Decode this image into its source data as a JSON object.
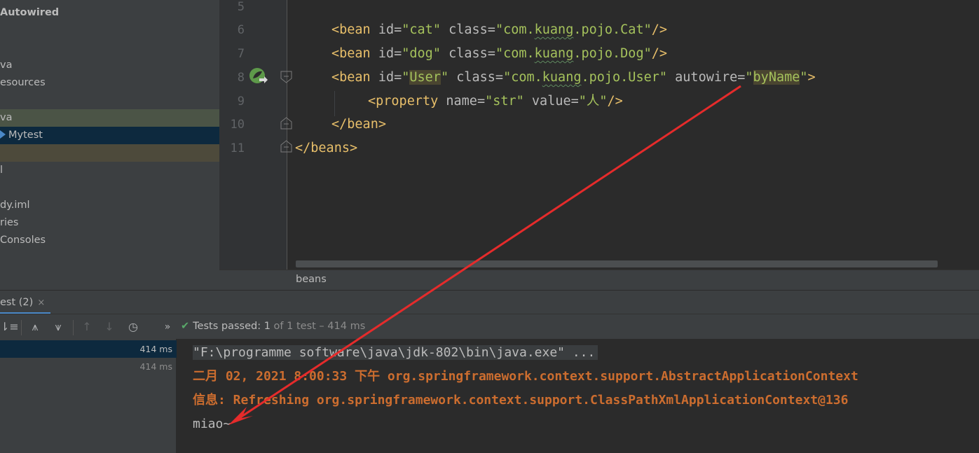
{
  "project_tree": {
    "items": [
      {
        "label": "Autowired",
        "style": "bold"
      },
      {
        "label": "va",
        "style": ""
      },
      {
        "label": "esources",
        "style": ""
      },
      {
        "label": "va",
        "style": "sel-green"
      },
      {
        "label": "Mytest",
        "style": "sel-blue"
      },
      {
        "label": "",
        "style": "sel-olive"
      },
      {
        "label": "l",
        "style": ""
      },
      {
        "label": "dy.iml",
        "style": ""
      },
      {
        "label": "ries",
        "style": ""
      },
      {
        "label": " Consoles",
        "style": ""
      }
    ]
  },
  "editor": {
    "line_numbers": [
      "5",
      "6",
      "7",
      "8",
      "9",
      "10",
      "11"
    ],
    "lines": {
      "l6": {
        "open": "<bean",
        "id_attr": " id=",
        "id_val": "\"cat\"",
        "class_attr": " class=",
        "class_val_pre": "\"com.",
        "class_val_wavy": "kuang",
        "class_val_post": ".pojo.Cat\"",
        "close": "/>"
      },
      "l7": {
        "open": "<bean",
        "id_attr": " id=",
        "id_val": "\"dog\"",
        "class_attr": " class=",
        "class_val_pre": "\"com.",
        "class_val_wavy": "kuang",
        "class_val_post": ".pojo.Dog\"",
        "close": "/>"
      },
      "l8": {
        "open": "<bean",
        "id_attr": " id=",
        "id_q1": "\"",
        "id_val": "User",
        "id_q2": "\"",
        "class_attr": " class=",
        "class_val_pre": "\"com.",
        "class_val_wavy": "kuang",
        "class_val_post": ".pojo.User\"",
        "aw_attr": " autowire=",
        "aw_q1": "\"",
        "aw_val": "byName",
        "aw_q2": "\"",
        "close": ">"
      },
      "l9": {
        "open": "<property",
        "name_attr": " name=",
        "name_val": "\"str\"",
        "value_attr": " value=",
        "value_val": "\"人\"",
        "close": "/>"
      },
      "l10": {
        "text": "</bean>"
      },
      "l11": {
        "text": "</beans>"
      }
    }
  },
  "breadcrumb": {
    "label": "beans"
  },
  "run": {
    "tab_label": "est (2)",
    "tab_close": "×",
    "tests_passed_label": "Tests passed:",
    "tests_passed_count": "1",
    "tests_passed_rest": "of 1 test – 414 ms",
    "toolbar_more": "»",
    "test_rows": [
      {
        "time": "414 ms"
      },
      {
        "time": "414 ms"
      }
    ],
    "console": [
      "\"F:\\programme software\\java\\jdk-802\\bin\\java.exe\" ...",
      "二月 02, 2021 8:00:33 下午 org.springframework.context.support.AbstractApplicationContext",
      "信息: Refreshing org.springframework.context.support.ClassPathXmlApplicationContext@136",
      "miao~"
    ]
  },
  "colors": {
    "annotation_arrow": "#e52b2b",
    "tag": "#e8bf6a",
    "string": "#a5c25c",
    "console_error": "#cc6d2f"
  }
}
